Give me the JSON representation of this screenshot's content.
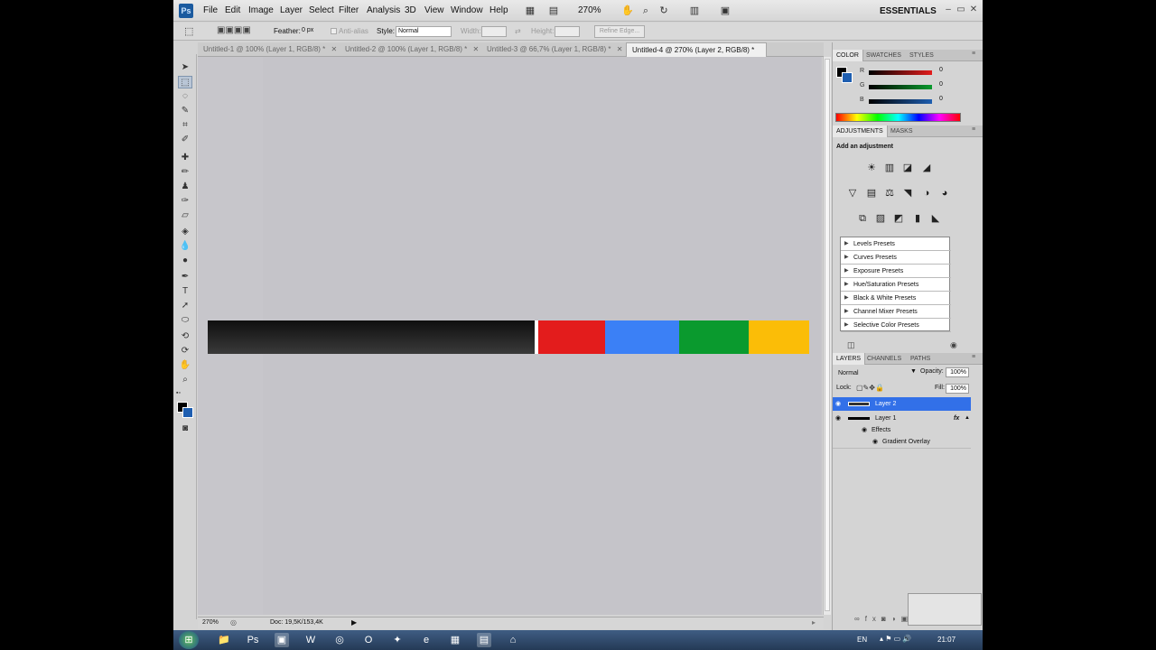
{
  "app": {
    "logo": "Ps",
    "menu": [
      "File",
      "Edit",
      "Image",
      "Layer",
      "Select",
      "Filter",
      "Analysis",
      "3D",
      "View",
      "Window",
      "Help"
    ],
    "zoom": "270%",
    "workspace": "ESSENTIALS",
    "window_controls": [
      "–",
      "▭",
      "✕"
    ]
  },
  "options": {
    "feather_label": "Feather:",
    "feather_value": "0 px",
    "antialias_label": "Anti-alias",
    "style_label": "Style:",
    "style_value": "Normal",
    "width_label": "Width:",
    "height_label": "Height:",
    "refine_edge": "Refine Edge..."
  },
  "tabs": [
    {
      "label": "Untitled-1 @ 100% (Layer 1, RGB/8) *",
      "close": "✕"
    },
    {
      "label": "Untitled-2 @ 100% (Layer 1, RGB/8) *",
      "close": "✕"
    },
    {
      "label": "Untitled-3 @ 66,7% (Layer 1, RGB/8) *",
      "close": "✕"
    },
    {
      "label": "Untitled-4 @ 270% (Layer 2, RGB/8) *",
      "close": "✕"
    }
  ],
  "canvas": {
    "bar_colors": {
      "black": "#1f1f1f",
      "red": "#e31c1c",
      "blue": "#3b80f6",
      "green": "#0a9a2e",
      "yellow": "#fbbd07"
    }
  },
  "status": {
    "zoom": "270%",
    "doc": "Doc: 19,5K/153,4K"
  },
  "color_panel": {
    "tabs": [
      "COLOR",
      "SWATCHES",
      "STYLES"
    ],
    "sliders": [
      {
        "label": "R",
        "value": "0",
        "color": "#e31c1c"
      },
      {
        "label": "G",
        "value": "0",
        "color": "#0a9a2e"
      },
      {
        "label": "B",
        "value": "0",
        "color": "#1e5eb0"
      }
    ]
  },
  "adjustments": {
    "tabs": [
      "ADJUSTMENTS",
      "MASKS"
    ],
    "header": "Add an adjustment",
    "icons_row1": [
      "☀",
      "▥",
      "◪",
      "◢"
    ],
    "icons_row2": [
      "▽",
      "▤",
      "⚖",
      "◥",
      "◑",
      "◕"
    ],
    "icons_row3": [
      "⧉",
      "▨",
      "◩",
      "▮",
      "◣"
    ],
    "presets": [
      "Levels Presets",
      "Curves Presets",
      "Exposure Presets",
      "Hue/Saturation Presets",
      "Black & White Presets",
      "Channel Mixer Presets",
      "Selective Color Presets"
    ]
  },
  "layers": {
    "tabs": [
      "LAYERS",
      "CHANNELS",
      "PATHS"
    ],
    "blend_mode": "Normal",
    "opacity_label": "Opacity:",
    "opacity": "100%",
    "lock_label": "Lock:",
    "fill_label": "Fill:",
    "fill": "100%",
    "items": [
      {
        "name": "Layer 2"
      },
      {
        "name": "Layer 1",
        "fx": "fx"
      },
      {
        "name": "Effects"
      },
      {
        "name": "Gradient Overlay"
      }
    ]
  },
  "taskbar": {
    "lang": "EN",
    "time": "21:07"
  }
}
